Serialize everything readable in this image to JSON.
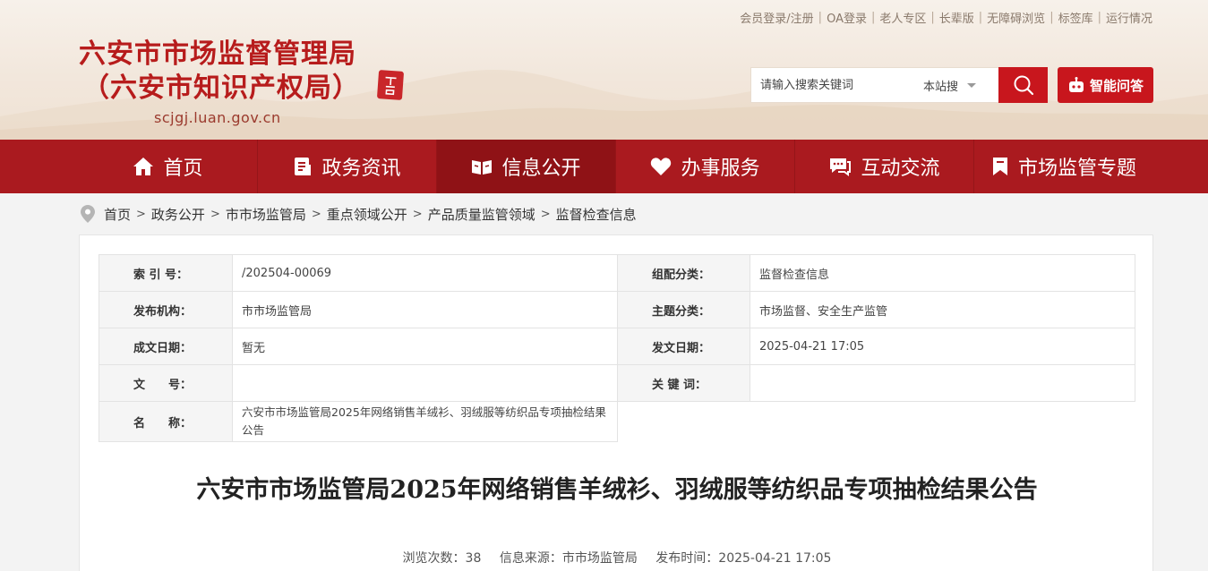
{
  "top_links": [
    "会员登录/注册",
    "OA登录",
    "老人专区",
    "长辈版",
    "无障碍浏览",
    "标签库",
    "运行情况"
  ],
  "logo": {
    "line1": "六安市市场监督管理局",
    "line2": "（六安市知识产权局）",
    "domain": "scjgj.luan.gov.cn"
  },
  "search": {
    "placeholder": "请输入搜索关键词",
    "scope": "本站搜"
  },
  "ai_button": "智能问答",
  "nav": [
    {
      "label": "首页",
      "icon": "home-icon"
    },
    {
      "label": "政务资讯",
      "icon": "news-icon"
    },
    {
      "label": "信息公开",
      "icon": "info-open-icon"
    },
    {
      "label": "办事服务",
      "icon": "heart-icon"
    },
    {
      "label": "互动交流",
      "icon": "chat-icon"
    },
    {
      "label": "市场监管专题",
      "icon": "bookmark-icon"
    }
  ],
  "breadcrumb": [
    "首页",
    "政务公开",
    "市市场监管局",
    "重点领域公开",
    "产品质量监管领域",
    "监督检查信息"
  ],
  "meta": {
    "index_label": "索 引 号：",
    "index_value": "/202504-00069",
    "category_label": "组配分类：",
    "category_value": "监督检查信息",
    "org_label": "发布机构：",
    "org_value": "市市场监管局",
    "topic_label": "主题分类：",
    "topic_value": "市场监督、安全生产监管",
    "created_label": "成文日期：",
    "created_value": "暂无",
    "published_label": "发文日期：",
    "published_value": "2025-04-21 17:05",
    "docno_label": "文　　号：",
    "docno_value": "",
    "keywords_label": "关 键 词：",
    "keywords_value": "",
    "name_label": "名　　称：",
    "name_value": "六安市市场监管局2025年网络销售羊绒衫、羽绒服等纺织品专项抽检结果公告"
  },
  "article": {
    "title": "六安市市场监管局2025年网络销售羊绒衫、羽绒服等纺织品专项抽检结果公告",
    "views": "浏览次数：38",
    "source": "信息来源：市市场监管局",
    "time": "发布时间：2025-04-21 17:05"
  }
}
